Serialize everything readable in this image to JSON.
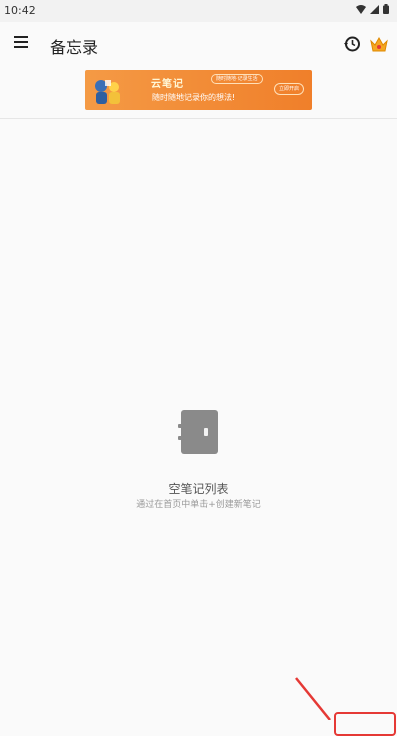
{
  "status_bar": {
    "time": "10:42"
  },
  "app_bar": {
    "title": "备忘录"
  },
  "banner": {
    "title": "云笔记",
    "subtitle": "随时随地记录你的想法!",
    "pill": "随时随地·记录生活",
    "button": "立即开启"
  },
  "empty_state": {
    "title": "空笔记列表",
    "hint": "通过在首页中单击+创建新笔记"
  },
  "colors": {
    "accent": "#f07f2a",
    "annotation": "#e53935",
    "background": "#fafafa"
  },
  "icons": [
    "menu-icon",
    "history-icon",
    "vip-crown-icon",
    "notebook-icon",
    "wifi-icon",
    "signal-icon",
    "battery-icon"
  ]
}
